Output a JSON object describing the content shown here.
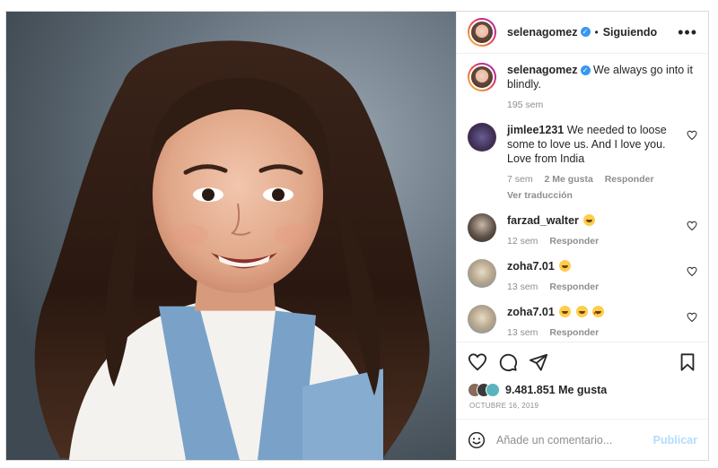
{
  "post": {
    "author": "selenagomez",
    "following_label": "Siguiendo",
    "separator": "•",
    "more_label": "•••",
    "colors": {
      "accent": "#3897f0",
      "publish_disabled": "#b3dbff",
      "muted": "#8e8e8e"
    }
  },
  "caption": {
    "username": "selenagomez",
    "text": "We always go into it blindly.",
    "time": "195 sem"
  },
  "comments": [
    {
      "username": "jimlee1231",
      "text": "We needed to loose some to love us. And I love you. Love from India",
      "time": "7 sem",
      "likes": "2 Me gusta",
      "reply": "Responder",
      "translate": "Ver traducción"
    },
    {
      "username": "farzad_walter",
      "emoji": "grinning-face-sweat",
      "time": "12 sem",
      "reply": "Responder"
    },
    {
      "username": "zoha7.01",
      "emoji": "grinning-face-sweat",
      "time": "13 sem",
      "reply": "Responder"
    },
    {
      "username": "zoha7.01",
      "emoji": "grinning-faces-heart-eyes",
      "time": "13 sem",
      "reply": "Responder"
    }
  ],
  "stats": {
    "likes": "9.481.851 Me gusta",
    "date": "OCTUBRE 16, 2019"
  },
  "add_comment": {
    "placeholder": "Añade un comentario...",
    "publish_label": "Publicar"
  },
  "icons": {
    "like": "heart-icon",
    "comment": "comment-icon",
    "share": "paper-plane-icon",
    "save": "bookmark-icon",
    "emoji": "smiley-icon"
  }
}
